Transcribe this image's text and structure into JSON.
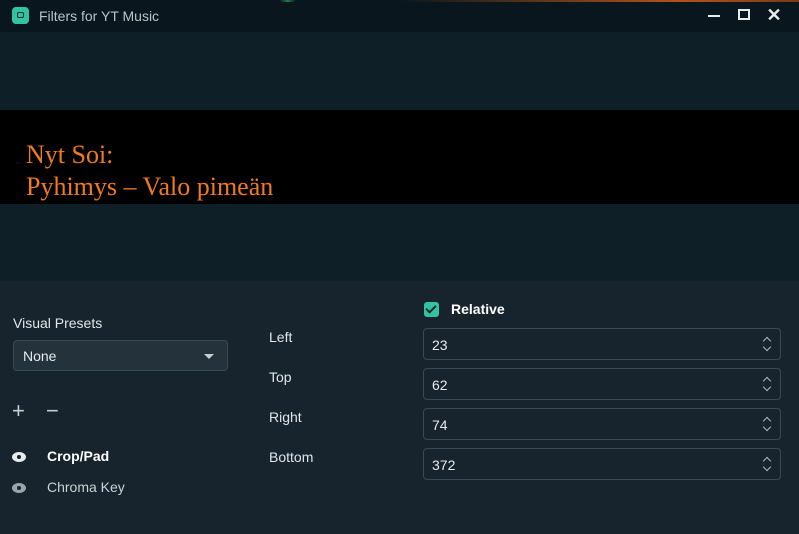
{
  "window": {
    "title": "Filters for YT Music",
    "icon": "app-icon",
    "controls": [
      "minimize-icon",
      "maximize-icon",
      "close-icon"
    ],
    "accent_color": "#31c3a2"
  },
  "preview": {
    "line1": "Nyt Soi:",
    "line2": "Pyhimys – Valo pimeän",
    "text_color": "#f07a1e"
  },
  "presets": {
    "label": "Visual Presets",
    "selected": "None",
    "add_symbol": "+",
    "remove_symbol": "−"
  },
  "filters": [
    {
      "name": "Crop/Pad",
      "visible": true,
      "selected": true
    },
    {
      "name": "Chroma Key",
      "visible": true,
      "selected": false
    }
  ],
  "crop": {
    "relative_label": "Relative",
    "relative_checked": true,
    "fields": [
      {
        "label": "Left",
        "value": "23"
      },
      {
        "label": "Top",
        "value": "62"
      },
      {
        "label": "Right",
        "value": "74"
      },
      {
        "label": "Bottom",
        "value": "372"
      }
    ]
  }
}
